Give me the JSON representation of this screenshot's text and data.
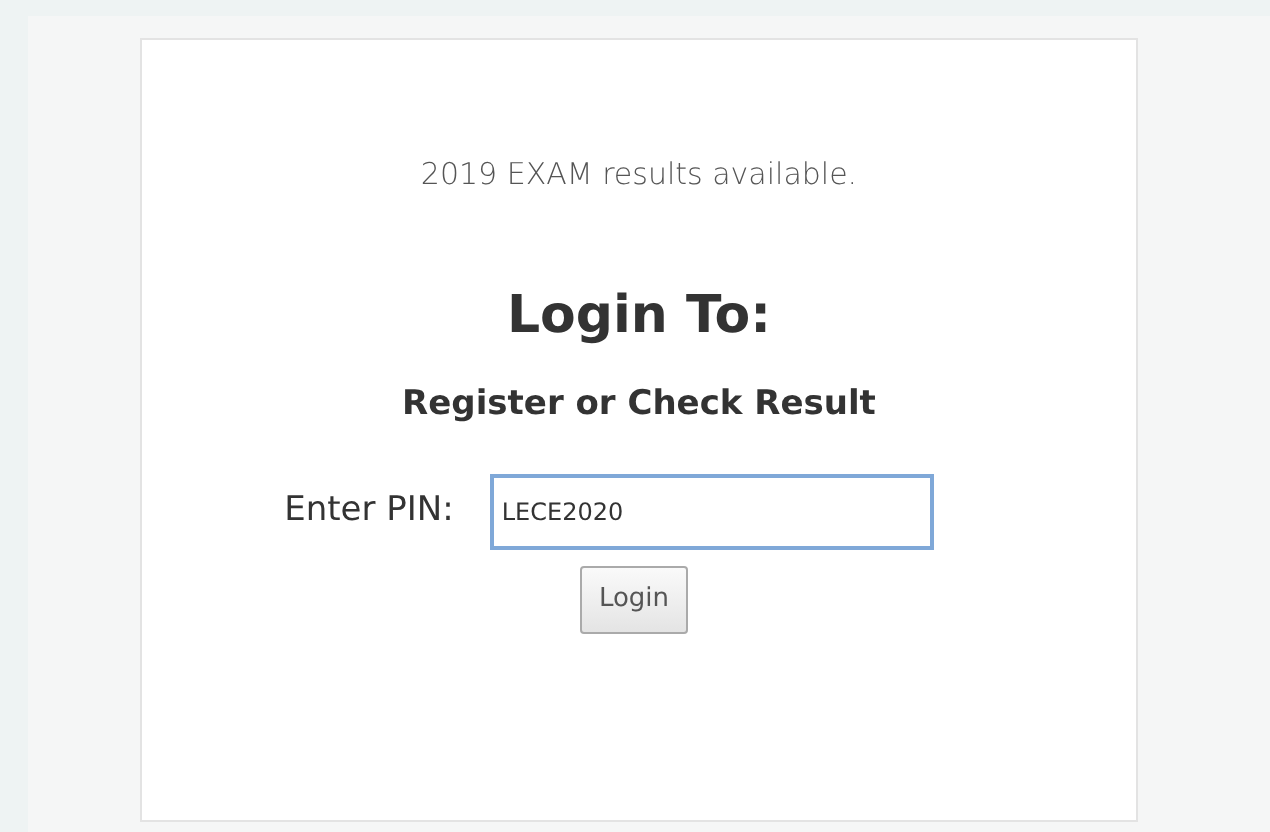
{
  "notice": "2019 EXAM results available.",
  "heading": "Login To:",
  "subheading": "Register or Check Result",
  "pin_field": {
    "label": "Enter PIN:",
    "value": "LECE2020",
    "focused": true
  },
  "button": "Login"
}
